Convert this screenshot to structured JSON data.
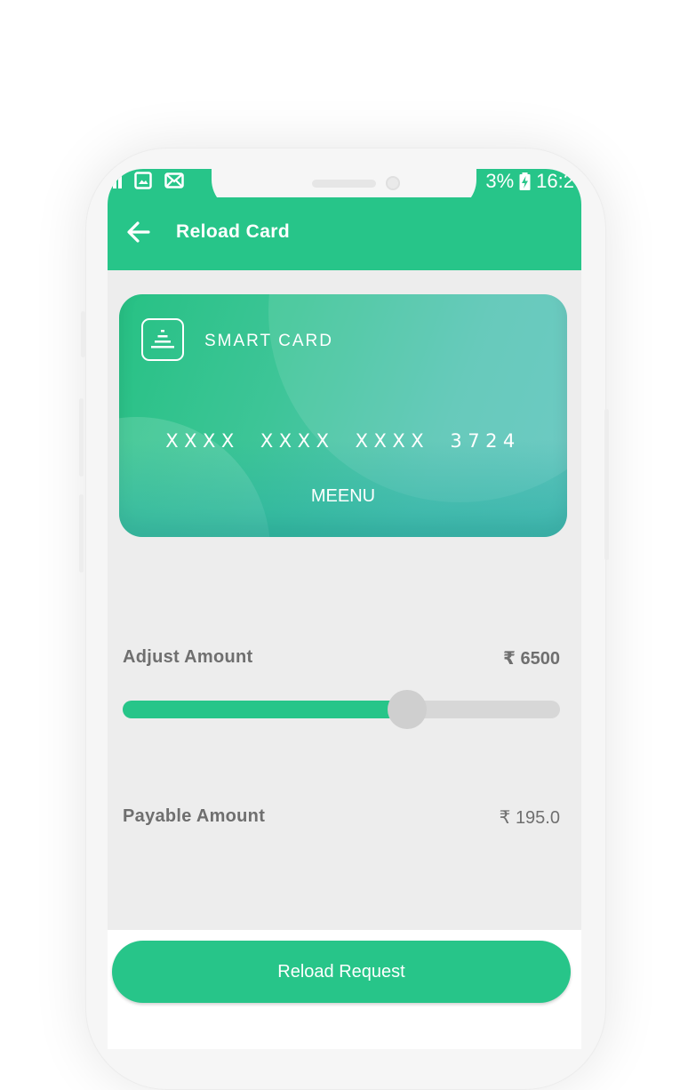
{
  "status_bar": {
    "battery_text": "3%",
    "time": "16:2",
    "icons": [
      "signal-icon",
      "image-notification-icon",
      "mail-notification-icon",
      "battery-charging-icon"
    ]
  },
  "app_bar": {
    "title": "Reload Card",
    "back_icon": "arrow-left-icon"
  },
  "card": {
    "brand": "SMART CARD",
    "number": "XXXX XXXX XXXX 3724",
    "holder": "MEENU",
    "logo_icon": "smart-card-logo-icon"
  },
  "adjust_amount": {
    "label": "Adjust Amount",
    "value": "₹ 6500",
    "slider_fraction": 0.65
  },
  "payable_amount": {
    "label": "Payable Amount",
    "value": "₹ 195.0"
  },
  "actions": {
    "reload_label": "Reload Request"
  },
  "colors": {
    "primary": "#27c589",
    "background": "#ededed",
    "text_muted": "#6f6f6f"
  }
}
